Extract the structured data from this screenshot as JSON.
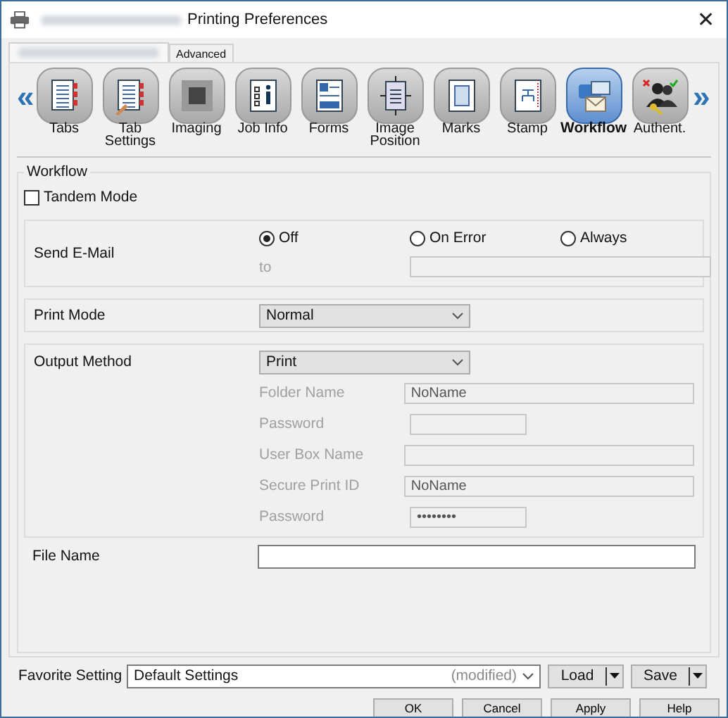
{
  "window": {
    "title": "Printing Preferences",
    "close": "✕"
  },
  "tabs": [
    {
      "kind": "redacted",
      "selected": true
    },
    {
      "kind": "text",
      "label": "Advanced",
      "selected": false
    }
  ],
  "toolbar": {
    "prev": "«",
    "next": "»",
    "items": [
      {
        "label": "Tabs",
        "selected": false
      },
      {
        "label": "Tab\nSettings",
        "selected": false
      },
      {
        "label": "Imaging",
        "selected": false
      },
      {
        "label": "Job Info",
        "selected": false
      },
      {
        "label": "Forms",
        "selected": false
      },
      {
        "label": "Image\nPosition",
        "selected": false
      },
      {
        "label": "Marks",
        "selected": false
      },
      {
        "label": "Stamp",
        "selected": false
      },
      {
        "label": "Workflow",
        "selected": true
      },
      {
        "label": "Authent.",
        "selected": false
      }
    ]
  },
  "workflow": {
    "title": "Workflow",
    "tandem_mode": {
      "label": "Tandem Mode",
      "checked": false
    },
    "send_email": {
      "label": "Send E-Mail",
      "options": [
        {
          "label": "Off",
          "selected": true
        },
        {
          "label": "On Error",
          "selected": false
        },
        {
          "label": "Always",
          "selected": false
        }
      ],
      "to_label": "to",
      "disabled": true
    },
    "print_mode": {
      "label": "Print Mode",
      "value": "Normal"
    },
    "output_method": {
      "label": "Output Method",
      "value": "Print",
      "fields": [
        {
          "label": "Folder Name",
          "value": "NoName",
          "kind": "wide",
          "disabled": true
        },
        {
          "label": "Password",
          "kind": "short",
          "disabled": true
        },
        {
          "label": "User Box Name",
          "kind": "wide",
          "disabled": true
        },
        {
          "label": "Secure Print ID",
          "value": "NoName",
          "kind": "wide",
          "disabled": true
        },
        {
          "label": "Password",
          "value": "••••••••",
          "kind": "short",
          "disabled": true
        }
      ]
    },
    "file_name": {
      "label": "File Name"
    }
  },
  "favorite": {
    "label": "Favorite Setting",
    "value": "Default Settings",
    "suffix": "(modified)",
    "buttons": [
      "Load",
      "Save"
    ]
  },
  "buttons": [
    "OK",
    "Cancel",
    "Apply",
    "Help"
  ]
}
